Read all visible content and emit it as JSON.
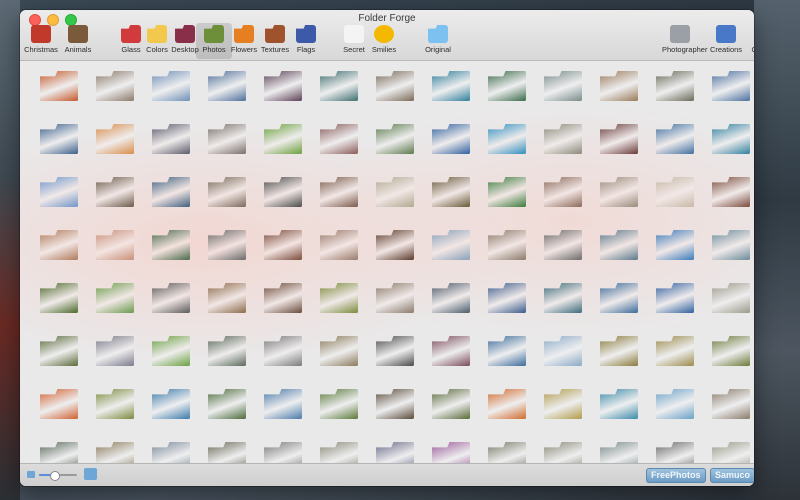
{
  "window": {
    "title": "Folder Forge"
  },
  "toolbar": {
    "items": [
      {
        "label": "Christmas",
        "color": "#c0392b",
        "icon": "christmas-icon"
      },
      {
        "label": "Animals",
        "color": "#7a5a3a",
        "icon": "animals-icon"
      },
      {
        "label": "Glass",
        "color": "#d23b3b",
        "icon": "glass-folder-icon"
      },
      {
        "label": "Colors",
        "color": "#f2c94c",
        "icon": "colors-folder-icon"
      },
      {
        "label": "Desktop",
        "color": "#8a2f4a",
        "icon": "desktop-folder-icon"
      },
      {
        "label": "Photos",
        "color": "#6d8f3a",
        "icon": "photos-folder-icon"
      },
      {
        "label": "Flowers",
        "color": "#e67e22",
        "icon": "flowers-folder-icon"
      },
      {
        "label": "Textures",
        "color": "#a0522d",
        "icon": "textures-folder-icon"
      },
      {
        "label": "Flags",
        "color": "#3c5aa8",
        "icon": "flags-folder-icon"
      },
      {
        "label": "Secret",
        "color": "#f4f4f4",
        "icon": "secret-document-icon"
      },
      {
        "label": "Smilies",
        "color": "#f5b800",
        "icon": "smilies-icon"
      },
      {
        "label": "Original",
        "color": "#7cc1ef",
        "icon": "original-folder-icon"
      },
      {
        "label": "Photographer",
        "color": "#9aa0a6",
        "icon": "photographer-camera-icon"
      },
      {
        "label": "Creations",
        "color": "#4a78c8",
        "icon": "creations-icon"
      },
      {
        "label": "Creator",
        "color": "#5a62c8",
        "icon": "creator-icon"
      }
    ],
    "selected": "Photos"
  },
  "status": {
    "zoom_level": 0.4,
    "badge_1": "FreePhotos",
    "badge_2": "Samuco"
  },
  "thumbnails": {
    "rows": [
      [
        "#c4582a",
        "#8a7a6a",
        "#6f8fb8",
        "#4f6f9a",
        "#5b3f55",
        "#3f6f6f",
        "#7a6a58",
        "#2f7f9a",
        "#3a6a4a",
        "#7a8a8a",
        "#9a7a5a",
        "#6a6a5a",
        "#4a6f9f"
      ],
      [
        "#3a5f8a",
        "#d98c4a",
        "#5a5a6a",
        "#7a6f6a",
        "#6a9f3a",
        "#8a5a5a",
        "#5a7a4a",
        "#2f5f9f",
        "#2f8fbf",
        "#8a8a7a",
        "#6a3a3a",
        "#3f6f9f",
        "#2f7f9f"
      ],
      [
        "#6f94c8",
        "#6a5a4a",
        "#3f5f7f",
        "#7a6a5a",
        "#4a4a4a",
        "#7a5a4a",
        "#b0a890",
        "#6a5a3a",
        "#3a7a3a",
        "#8a6a5a",
        "#9a8a7a",
        "#c8b8a8",
        "#7a4a3a"
      ],
      [
        "#b07a5a",
        "#c8907a",
        "#4a6a4a",
        "#6a6a6a",
        "#7a4a3a",
        "#9a7a6a",
        "#5a3a2a",
        "#8aa0b8",
        "#8a7a6a",
        "#6a6a6a",
        "#5a7a8a",
        "#3a7aba",
        "#6a8a9a"
      ],
      [
        "#4a6a2a",
        "#6a9a4a",
        "#5a5a5a",
        "#8a6a4a",
        "#6a4a3a",
        "#7a8a3a",
        "#8a7a6a",
        "#4a5a6a",
        "#3a5a8a",
        "#3a6a7a",
        "#3a6a9a",
        "#2f5f9f",
        "#9a9a8a"
      ],
      [
        "#5a6a3a",
        "#7a7a8a",
        "#6aa040",
        "#5a6a5a",
        "#7a7a7a",
        "#8a7a5a",
        "#4a4a4a",
        "#7a4a5a",
        "#3a6a9a",
        "#8aaac8",
        "#8a7a3a",
        "#9a8a4a",
        "#6a7a3a"
      ],
      [
        "#d06030",
        "#7a8a3a",
        "#3a7aaa",
        "#4a6a3a",
        "#4a7aaa",
        "#5a7a3a",
        "#5a4a3a",
        "#5a6a3a",
        "#d06a2a",
        "#b09a4a",
        "#3a8aaa",
        "#6aa0c8",
        "#8a7a6a"
      ],
      [
        "#5a6a5a",
        "#8a7a5a",
        "#7a8a9a",
        "#6a6a5a",
        "#7a7a7a",
        "#8a8a7a",
        "#6a6a8a",
        "#9a5a9a",
        "#7a7a6a",
        "#8a8a7a",
        "#7a8a8a",
        "#6a6a6a",
        "#9a9a8a"
      ]
    ]
  }
}
